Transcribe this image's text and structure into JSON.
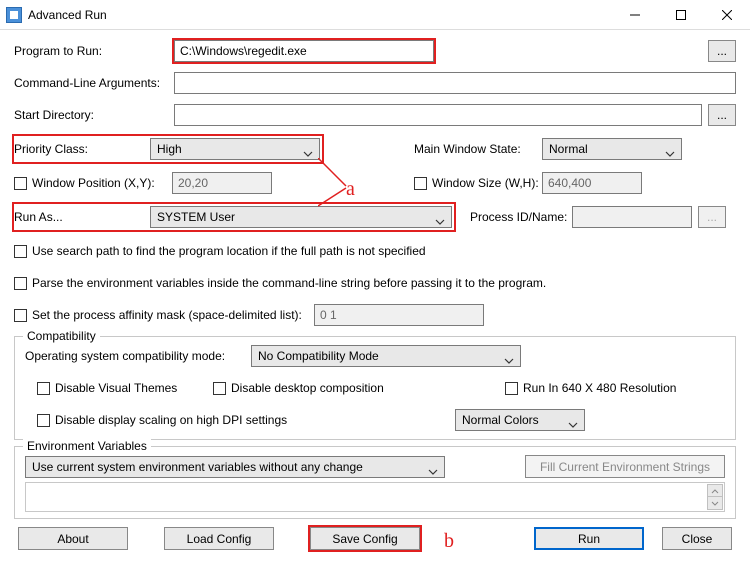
{
  "window": {
    "title": "Advanced Run"
  },
  "labels": {
    "program": "Program to Run:",
    "args": "Command-Line Arguments:",
    "startdir": "Start Directory:",
    "priority": "Priority Class:",
    "mainwin": "Main Window State:",
    "winpos": "Window Position (X,Y):",
    "winsize": "Window Size (W,H):",
    "runas": "Run As...",
    "pid": "Process ID/Name:",
    "searchpath": "Use search path to find the program location if the full path is not specified",
    "parseenv": "Parse the environment variables inside the command-line string before passing it to the program.",
    "affinity": "Set the process affinity mask (space-delimited list):",
    "compat_legend": "Compatibility",
    "osmode": "Operating system compatibility mode:",
    "dvthemes": "Disable Visual Themes",
    "ddesktop": "Disable desktop composition",
    "run640": "Run In 640 X 480 Resolution",
    "ddpi": "Disable display scaling on high DPI settings",
    "env_legend": "Environment Variables",
    "fillenv": "Fill Current Environment Strings"
  },
  "values": {
    "program": "C:\\Windows\\regedit.exe",
    "args": "",
    "startdir": "",
    "priority": "High",
    "mainwin": "Normal",
    "winpos": "20,20",
    "winsize": "640,400",
    "runas": "SYSTEM User",
    "pid": "",
    "affinity": "0 1",
    "osmode": "No Compatibility Mode",
    "colors": "Normal Colors",
    "envmode": "Use current system environment variables without any change",
    "browse": "..."
  },
  "buttons": {
    "about": "About",
    "load": "Load Config",
    "save": "Save Config",
    "run": "Run",
    "close": "Close"
  },
  "annotations": {
    "a": "a",
    "b": "b"
  }
}
